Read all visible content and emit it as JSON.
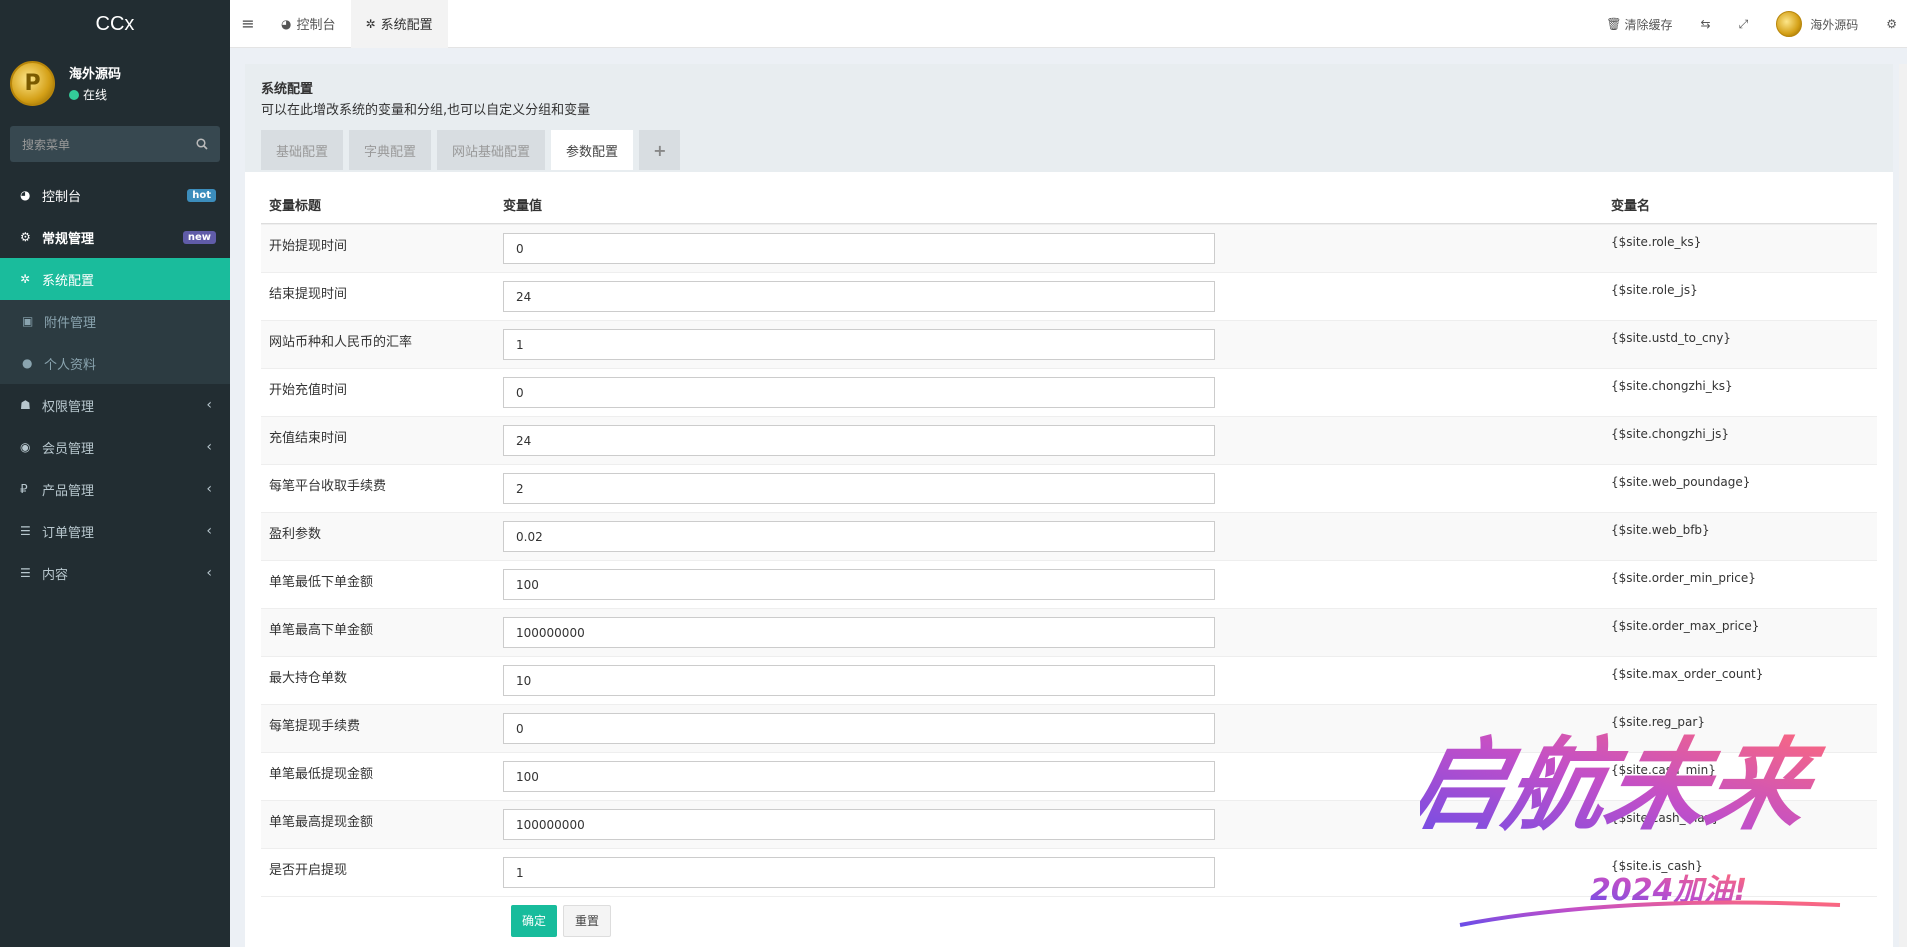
{
  "sidebar": {
    "logo": "CCx",
    "user": {
      "name": "海外源码",
      "status": "在线"
    },
    "search_placeholder": "搜索菜单",
    "items": [
      {
        "label": "控制台",
        "icon": "dashboard-icon",
        "badge": "hot"
      },
      {
        "label": "常规管理",
        "icon": "cogs-icon",
        "badge": "new"
      },
      {
        "label": "系统配置",
        "icon": "gear-icon",
        "active": true
      },
      {
        "label": "附件管理",
        "icon": "image-icon",
        "sub": true
      },
      {
        "label": "个人资料",
        "icon": "user-icon",
        "sub": true
      },
      {
        "label": "权限管理",
        "icon": "group-icon"
      },
      {
        "label": "会员管理",
        "icon": "user-circle-icon"
      },
      {
        "label": "产品管理",
        "icon": "ruble-icon"
      },
      {
        "label": "订单管理",
        "icon": "list-icon"
      },
      {
        "label": "内容",
        "icon": "list-icon"
      }
    ]
  },
  "header": {
    "tabs": [
      {
        "label": "控制台",
        "icon": "dashboard-icon"
      },
      {
        "label": "系统配置",
        "icon": "gear-icon"
      }
    ],
    "clear_cache": "清除缓存",
    "user_name": "海外源码"
  },
  "panel": {
    "title": "系统配置",
    "description": "可以在此增改系统的变量和分组,也可以自定义分组和变量",
    "tabs": [
      "基础配置",
      "字典配置",
      "网站基础配置",
      "参数配置",
      "+"
    ],
    "active_tab": "参数配置"
  },
  "table": {
    "headers": {
      "title": "变量标题",
      "value": "变量值",
      "name": "变量名"
    },
    "rows": [
      {
        "title": "开始提现时间",
        "value": "0",
        "name": "{$site.role_ks}"
      },
      {
        "title": "结束提现时间",
        "value": "24",
        "name": "{$site.role_js}"
      },
      {
        "title": "网站币种和人民币的汇率",
        "value": "1",
        "name": "{$site.ustd_to_cny}"
      },
      {
        "title": "开始充值时间",
        "value": "0",
        "name": "{$site.chongzhi_ks}"
      },
      {
        "title": "充值结束时间",
        "value": "24",
        "name": "{$site.chongzhi_js}"
      },
      {
        "title": "每笔平台收取手续费",
        "value": "2",
        "name": "{$site.web_poundage}"
      },
      {
        "title": "盈利参数",
        "value": "0.02",
        "name": "{$site.web_bfb}"
      },
      {
        "title": "单笔最低下单金额",
        "value": "100",
        "name": "{$site.order_min_price}"
      },
      {
        "title": "单笔最高下单金额",
        "value": "100000000",
        "name": "{$site.order_max_price}"
      },
      {
        "title": "最大持仓单数",
        "value": "10",
        "name": "{$site.max_order_count}"
      },
      {
        "title": "每笔提现手续费",
        "value": "0",
        "name": "{$site.reg_par}"
      },
      {
        "title": "单笔最低提现金额",
        "value": "100",
        "name": "{$site.cash_min}"
      },
      {
        "title": "单笔最高提现金额",
        "value": "100000000",
        "name": "{$site.cash_max}"
      },
      {
        "title": "是否开启提现",
        "value": "1",
        "name": "{$site.is_cash}"
      }
    ],
    "submit_label": "确定",
    "reset_label": "重置"
  },
  "watermark": {
    "main": "启航未来",
    "sub": "2024加油!"
  },
  "colors": {
    "sidebar_bg": "#222d32",
    "accent": "#18bc9c",
    "active_menu": "#1abc9c"
  }
}
